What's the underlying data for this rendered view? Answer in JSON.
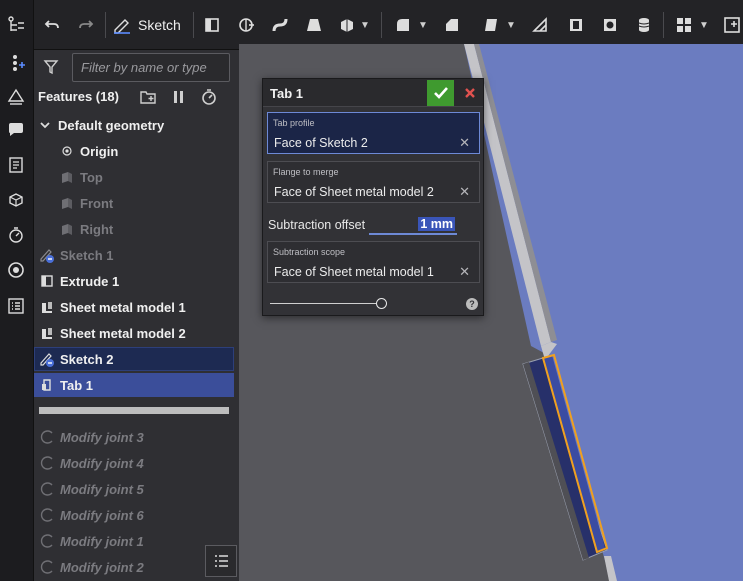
{
  "toolbar": {
    "sketch_label": "Sketch"
  },
  "feature_panel": {
    "filter_placeholder": "Filter by name or type",
    "title": "Features (18)",
    "default_geometry": "Default geometry",
    "items": [
      {
        "label": "Origin",
        "icon": "origin-icon",
        "state": "normal"
      },
      {
        "label": "Top",
        "icon": "plane-icon",
        "state": "dim"
      },
      {
        "label": "Front",
        "icon": "plane-icon",
        "state": "dim"
      },
      {
        "label": "Right",
        "icon": "plane-icon",
        "state": "dim"
      },
      {
        "label": "Sketch 1",
        "icon": "sketch-icon",
        "state": "dim"
      },
      {
        "label": "Extrude 1",
        "icon": "extrude-icon",
        "state": "normal"
      },
      {
        "label": "Sheet metal model 1",
        "icon": "sheet-metal-icon",
        "state": "normal"
      },
      {
        "label": "Sheet metal model 2",
        "icon": "sheet-metal-icon",
        "state": "normal"
      },
      {
        "label": "Sketch 2",
        "icon": "sketch-icon",
        "state": "selected-dark"
      },
      {
        "label": "Tab 1",
        "icon": "tab-icon",
        "state": "selected"
      }
    ],
    "joints": [
      "Modify joint 3",
      "Modify joint 4",
      "Modify joint 5",
      "Modify joint 6",
      "Modify joint 1",
      "Modify joint 2"
    ]
  },
  "dialog": {
    "title": "Tab 1",
    "tab_profile": {
      "label": "Tab profile",
      "value": "Face of Sketch 2"
    },
    "flange_to_merge": {
      "label": "Flange to merge",
      "value": "Face of Sheet metal model 2"
    },
    "subtraction_offset": {
      "label": "Subtraction offset",
      "value": "1 mm"
    },
    "subtraction_scope": {
      "label": "Subtraction scope",
      "value": "Face of Sheet metal model 1"
    },
    "help": "?"
  },
  "colors": {
    "selection": "#3b4e9a",
    "part_face": "#6b7cc0",
    "highlight_edge": "#f0a020",
    "confirm": "#3f9a2f",
    "cancel": "#e0524f"
  }
}
